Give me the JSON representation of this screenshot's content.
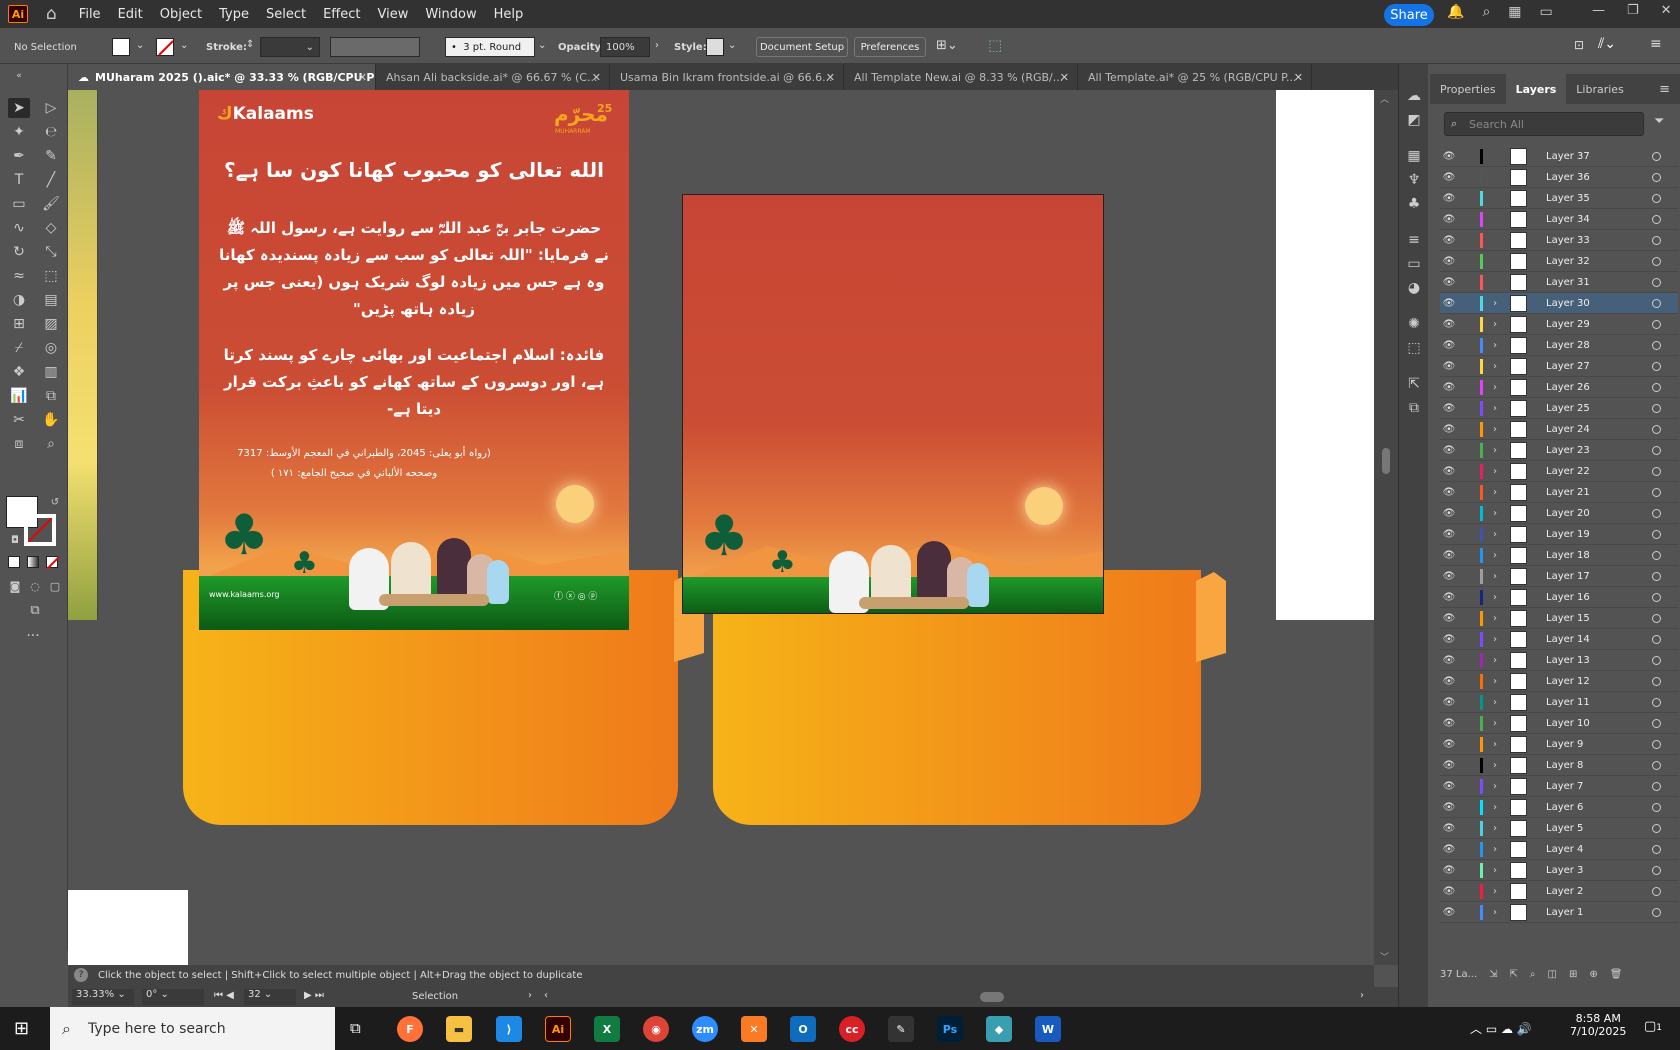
{
  "app": {
    "logo": "Ai",
    "menus": [
      "File",
      "Edit",
      "Object",
      "Type",
      "Select",
      "Effect",
      "View",
      "Window",
      "Help"
    ],
    "share": "Share"
  },
  "control": {
    "selection": "No Selection",
    "stroke_label": "Stroke:",
    "brush": "3 pt. Round",
    "opacity_label": "Opacity:",
    "opacity": "100%",
    "style_label": "Style:",
    "document_setup": "Document Setup",
    "preferences": "Preferences"
  },
  "tabs": [
    {
      "label": "MUharam 2025 ().aic* @ 33.33 % (RGB/CPU Preview)"
    },
    {
      "label": "Ahsan Ali backside.ai* @ 66.67 % (C..."
    },
    {
      "label": "Usama Bin Ikram frontside.ai @ 66.6..."
    },
    {
      "label": "All Template New.ai @ 8.33 % (RGB/..."
    },
    {
      "label": "All Template.ai* @ 25 % (RGB/CPU P..."
    }
  ],
  "artwork": {
    "brand": "Kalaams",
    "badge": "محرّم",
    "badge_num": "25",
    "badge_sub": "MUHARRAM",
    "heading": "الله تعالی کو محبوب کھانا کون سا ہے؟",
    "para1": "حضرت جابر بنؓ عبد اللہؓ سے روایت ہے، رسول اللہ ﷺ نے فرمایا: \"اللہ تعالی کو سب سے زیادہ پسندیدہ کھانا وہ ہے جس میں زیادہ لوگ شریک ہوں (یعنی جس پر زیادہ ہاتھ پڑیں\"",
    "para2": "فائدہ: اسلام اجتماعیت اور بھائی چارے کو پسند کرتا ہے، اور دوسروں کے ساتھ کھانے کو باعثِ برکت قرار دیتا ہے-",
    "ref1": "(رواہ أبو يعلى: 2045، والطبراني في المعجم الأوسط: 7317",
    "ref2": "وصححه الألباني في صحيح الجامع: ١٧١ )",
    "website": "www.kalaams.org"
  },
  "status": {
    "hint": "Click the object to select  |  Shift+Click to select multiple object  |  Alt+Drag the object to duplicate",
    "zoom": "33.33%",
    "rotate": "0°",
    "artboard": "32",
    "mode": "Selection"
  },
  "panel": {
    "tabs": [
      "Properties",
      "Layers",
      "Libraries"
    ],
    "search_placeholder": "Search All",
    "layers": [
      "Layer 37",
      "Layer 36",
      "Layer 35",
      "Layer 34",
      "Layer 33",
      "Layer 32",
      "Layer 31",
      "Layer 30",
      "Layer 29",
      "Layer 28",
      "Layer 27",
      "Layer 26",
      "Layer 25",
      "Layer 24",
      "Layer 23",
      "Layer 22",
      "Layer 21",
      "Layer 20",
      "Layer 19",
      "Layer 18",
      "Layer 17",
      "Layer 16",
      "Layer 15",
      "Layer 14",
      "Layer 13",
      "Layer 12",
      "Layer 11",
      "Layer 10",
      "Layer 9",
      "Layer 8",
      "Layer 7",
      "Layer 6",
      "Layer 5",
      "Layer 4",
      "Layer 3",
      "Layer 2",
      "Layer 1"
    ],
    "layer_colors": [
      "#000000",
      "#555555",
      "#4dd9e0",
      "#e040fb",
      "#ff5555",
      "#55cc55",
      "#ff5555",
      "#4dd9e0",
      "#ffd740",
      "#448aff",
      "#ffd740",
      "#e040fb",
      "#7c4dff",
      "#ff9800",
      "#4caf50",
      "#e91e63",
      "#ff5722",
      "#00bcd4",
      "#3f51b5",
      "#2196f3",
      "#9e9e9e",
      "#1a237e",
      "#ff9800",
      "#7c4dff",
      "#9c27b0",
      "#ff6d00",
      "#009688",
      "#4caf50",
      "#ff9800",
      "#000000",
      "#7c4dff",
      "#00e5ff",
      "#4dd0e1",
      "#2196f3",
      "#69f0ae",
      "#ff1744",
      "#448aff"
    ],
    "selected": "Layer 30",
    "footer": "37 La..."
  },
  "taskbar": {
    "search": "Type here to search",
    "time": "8:58 AM",
    "date": "7/10/2025",
    "notif": "1"
  }
}
